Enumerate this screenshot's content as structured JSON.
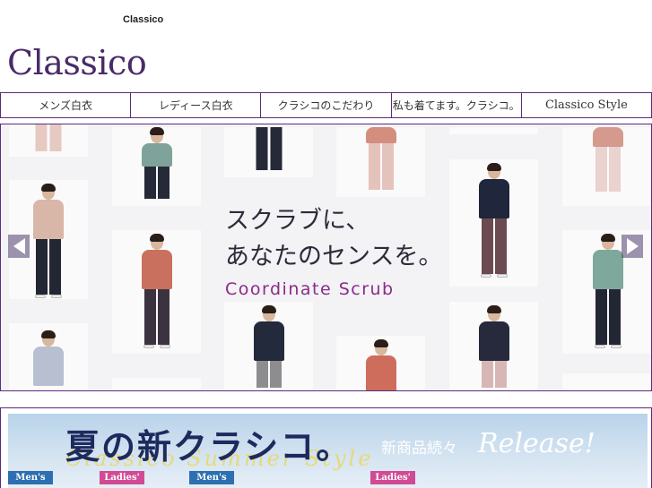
{
  "header": {
    "site_label": "Classico",
    "logo": "Classico"
  },
  "nav": [
    {
      "label": "メンズ白衣"
    },
    {
      "label": "レディース白衣"
    },
    {
      "label": "クラシコのこだわり"
    },
    {
      "label": "私も着てます。クラシコ。"
    },
    {
      "label": "Classico Style"
    }
  ],
  "hero": {
    "line1": "スクラブに、",
    "line2": "あなたのセンスを。",
    "subtitle": "Coordinate Scrub",
    "prev_icon": "triangle-left",
    "next_icon": "triangle-right"
  },
  "banner": {
    "title": "夏の新クラシコ。",
    "script": "Classico Summer Style",
    "new_items": "新商品続々",
    "release": "Release!",
    "tags": [
      "Men's",
      "Ladies'",
      "Men's",
      "Ladies'"
    ]
  },
  "colors": {
    "brand": "#5b2b7c",
    "nav_border": "#5b2b7c",
    "tag_men": "#2d6fb0",
    "tag_ladies": "#d14a94"
  }
}
